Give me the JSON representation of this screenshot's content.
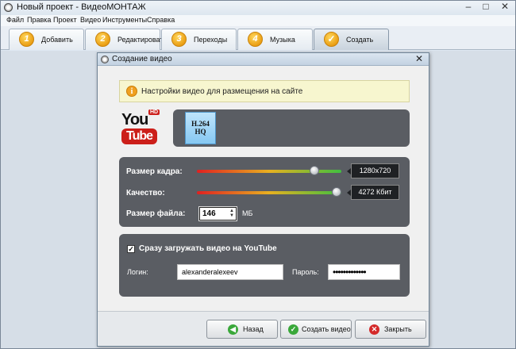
{
  "window": {
    "title": "Новый проект - ВидеоМОНТАЖ"
  },
  "menu": [
    "Файл",
    "Правка",
    "Проект",
    "Видео",
    "Инструменты",
    "Справка"
  ],
  "steps": [
    {
      "num": "1",
      "label": "Добавить"
    },
    {
      "num": "2",
      "label": "Редактировать"
    },
    {
      "num": "3",
      "label": "Переходы"
    },
    {
      "num": "4",
      "label": "Музыка"
    },
    {
      "num": "✓",
      "label": "Создать",
      "active": true
    }
  ],
  "dialog": {
    "title": "Создание видео",
    "info": "Настройки видео для размещения на сайте",
    "logo": {
      "you": "You",
      "tube": "Tube",
      "badge": "HD"
    },
    "format": {
      "line1": "H.264",
      "line2": "HQ"
    },
    "frame_size": {
      "label": "Размер кадра:",
      "value": "1280x720",
      "level": 0.84
    },
    "quality": {
      "label": "Качество:",
      "value": "4272 Кбит",
      "level": 1.0
    },
    "file_size": {
      "label": "Размер файла:",
      "value": "146",
      "unit": "МБ"
    },
    "upload": {
      "checked": true,
      "label": "Сразу загружать видео на YouTube",
      "login_label": "Логин:",
      "login_value": "alexanderalexeev",
      "password_label": "Пароль:",
      "password_value": "•••••••••••••"
    },
    "buttons": {
      "back": "Назад",
      "create": "Создать видео",
      "close": "Закрыть"
    }
  },
  "colors": {
    "panel": "#5a5d63",
    "accent": "#e99b10",
    "info_bg": "#f7f6cf"
  }
}
